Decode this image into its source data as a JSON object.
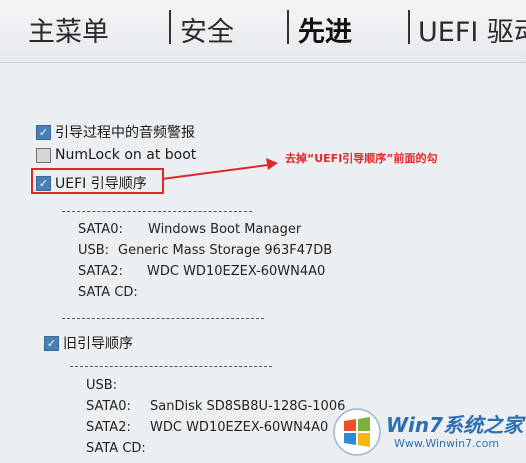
{
  "tabs": [
    {
      "label": "主菜单"
    },
    {
      "label": "安全"
    },
    {
      "label": "先进"
    },
    {
      "label": "UEFI 驱动"
    }
  ],
  "options": {
    "audio_alert": {
      "label": "引导过程中的音频警报",
      "checked": true
    },
    "numlock": {
      "label": "NumLock on at boot",
      "checked": false
    },
    "uefi_order": {
      "label": "UEFI 引导顺序",
      "checked": true
    },
    "legacy_order": {
      "label": "旧引导顺序",
      "checked": true
    }
  },
  "uefi_boot_list": [
    {
      "port": "SATA0:",
      "device": "Windows Boot Manager"
    },
    {
      "port": "USB:",
      "device": "Generic Mass Storage 963F47DB"
    },
    {
      "port": "SATA2:",
      "device": "WDC WD10EZEX-60WN4A0"
    },
    {
      "port": "SATA CD:",
      "device": ""
    }
  ],
  "legacy_boot_list": [
    {
      "port": "USB:",
      "device": ""
    },
    {
      "port": "SATA0:",
      "device": "SanDisk SD8SB8U-128G-1006"
    },
    {
      "port": "SATA2:",
      "device": "WDC WD10EZEX-60WN4A0"
    },
    {
      "port": "SATA CD:",
      "device": ""
    }
  ],
  "annotation": {
    "text": "去掉“UEFI引导顺序”前面的勾",
    "color": "#e0282c"
  },
  "watermark": {
    "brand": "Win7系统之家",
    "url": "Www.Winwin7.com"
  }
}
